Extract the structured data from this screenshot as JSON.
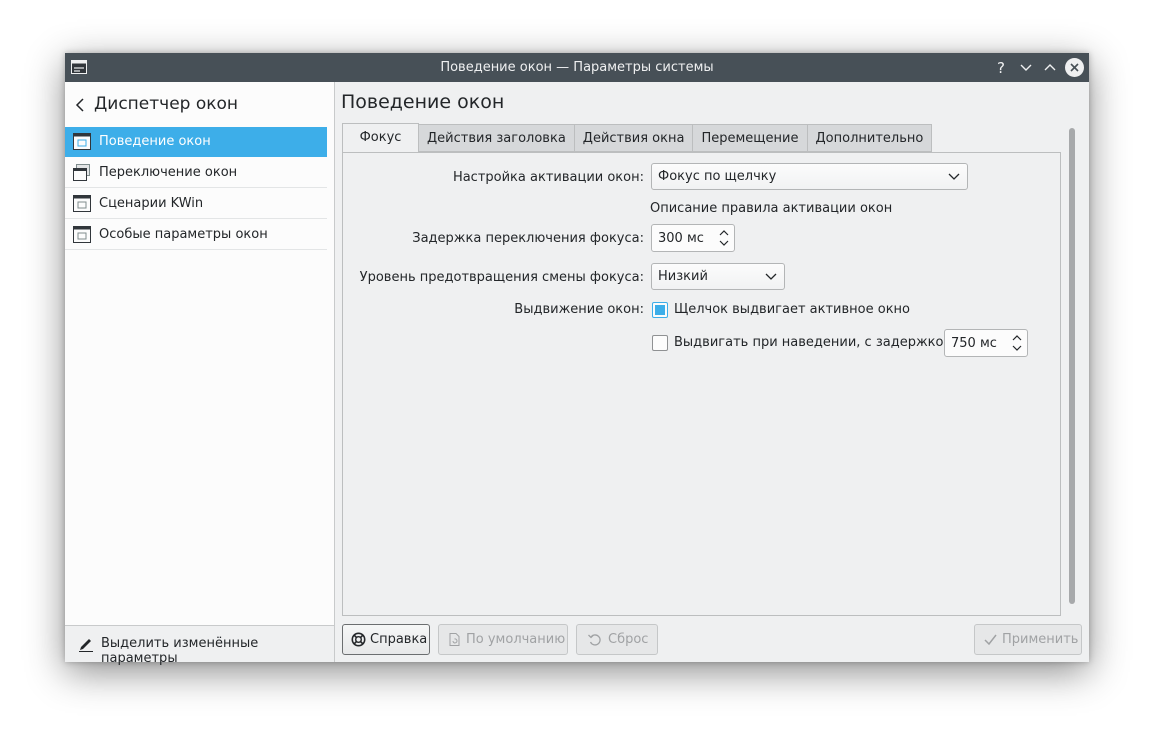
{
  "window": {
    "title": "Поведение окон — Параметры системы"
  },
  "titlebar_buttons": [
    "help-icon",
    "minimize-icon",
    "maximize-icon",
    "close-icon"
  ],
  "titlebar": {
    "help_glyph": "?"
  },
  "sidebar": {
    "back_title": "Диспетчер окон",
    "items": [
      {
        "label": "Поведение окон",
        "active": true,
        "icon": "window-behavior-icon"
      },
      {
        "label": "Переключение окон",
        "active": false,
        "icon": "task-switcher-icon"
      },
      {
        "label": "Сценарии KWin",
        "active": false,
        "icon": "kwin-scripts-icon"
      },
      {
        "label": "Особые параметры окон",
        "active": false,
        "icon": "window-rules-icon"
      }
    ],
    "footer_label": "Выделить изменённые параметры"
  },
  "main": {
    "page_title": "Поведение окон",
    "tabs": [
      {
        "label": "Фокус",
        "active": true
      },
      {
        "label": "Действия заголовка",
        "active": false
      },
      {
        "label": "Действия окна",
        "active": false
      },
      {
        "label": "Перемещение",
        "active": false
      },
      {
        "label": "Дополнительно",
        "active": false
      }
    ],
    "focus": {
      "activation_label": "Настройка активации окон:",
      "activation_value": "Фокус по щелчку",
      "activation_description": "Описание правила активации окон",
      "delay_label": "Задержка переключения фокуса:",
      "delay_value": "300 мс",
      "prevention_label": "Уровень предотвращения смены фокуса:",
      "prevention_value": "Низкий",
      "raise_label": "Выдвижение окон:",
      "click_raise_label": "Щелчок выдвигает активное окно",
      "click_raise_checked": true,
      "hover_raise_label": "Выдвигать при наведении, с задержкой:",
      "hover_raise_checked": false,
      "hover_delay_value": "750 мс"
    }
  },
  "buttons": {
    "help": "Справка",
    "defaults": "По умолчанию",
    "reset": "Сброс",
    "apply": "Применить"
  },
  "colors": {
    "accent": "#3daee9",
    "titlebar": "#475057",
    "background": "#eff0f1"
  }
}
